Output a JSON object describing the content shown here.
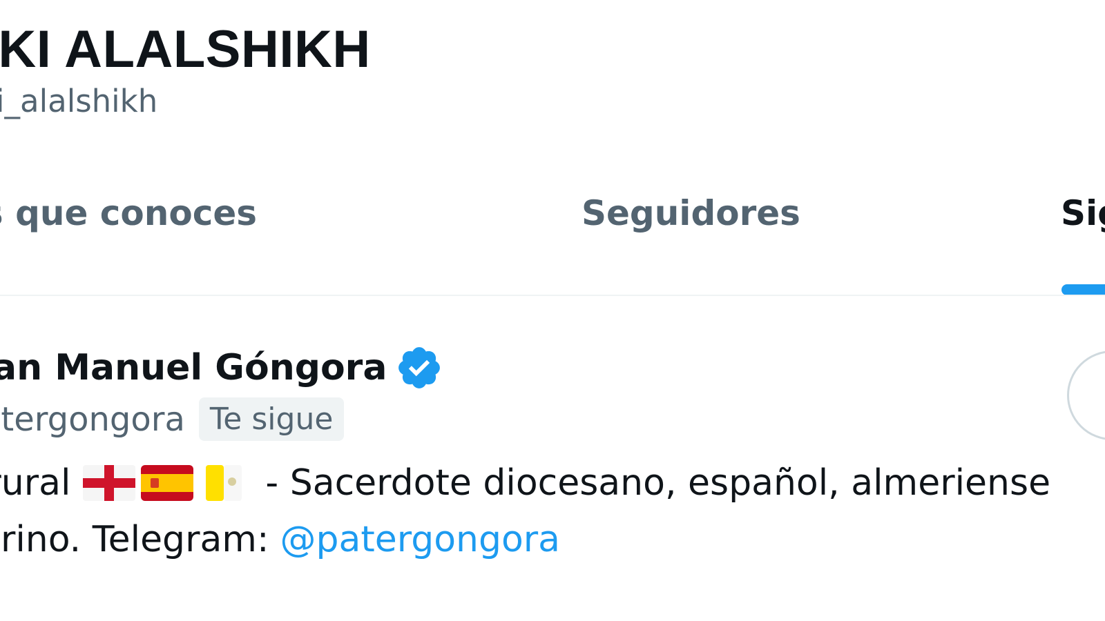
{
  "profile": {
    "name": "RKI ALALSHIKH",
    "handle": "ki_alalshikh"
  },
  "tabs": [
    {
      "label": "ores que conoces",
      "active": false
    },
    {
      "label": "Seguidores",
      "active": false
    },
    {
      "label": "Sig",
      "active": true
    }
  ],
  "user": {
    "name": "uan Manuel Góngora",
    "verified": true,
    "verified_icon": "verified-badge-icon",
    "handle": "atergongora",
    "follows_you_label": "Te sigue",
    "bio": {
      "line1_prefix": "a rural",
      "flags": [
        "england-flag-icon",
        "spain-flag-icon",
        "vatican-flag-icon"
      ],
      "line1_suffix": "- Sacerdote diocesano, español, almeriense",
      "line2_text": "urino. Telegram:",
      "line2_mention": "@patergongora"
    }
  },
  "colors": {
    "accent": "#1d9bf0",
    "text_primary": "#0f1419",
    "text_secondary": "#536471",
    "divider": "#eff3f4"
  }
}
